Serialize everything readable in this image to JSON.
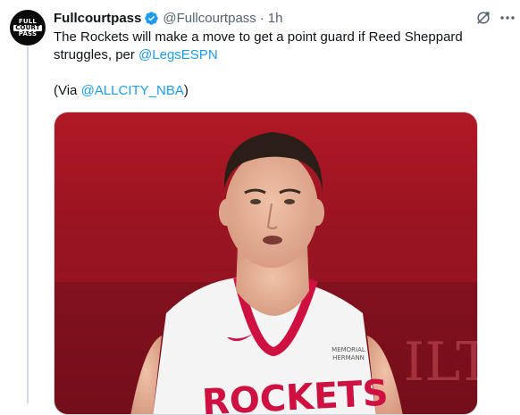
{
  "tweet": {
    "author_name": "Fullcourtpass",
    "author_handle": "@Fullcourtpass",
    "separator": "·",
    "time": "1h",
    "avatar_lines": [
      "FULL",
      "COURT",
      "PASS"
    ],
    "text_main": "The Rockets will make a move to get a point guard if Reed Sheppard struggles, per ",
    "mention_1": "@LegsESPN",
    "via_open": "(Via ",
    "mention_2": "@ALLCITY_NBA",
    "via_close": ")",
    "image": {
      "jersey_text": "ROCKETS",
      "sponsor_line1": "MEMORIAL",
      "sponsor_line2": "HERMANN",
      "background_letters": "ILT"
    }
  },
  "colors": {
    "link": "#1d9bf0",
    "verified": "#1d9bf0",
    "secondary_text": "#536471",
    "jersey_trim": "#ce1141"
  },
  "icons": {
    "verified": "verified-badge-icon",
    "grok": "grok-icon",
    "more": "more-icon"
  }
}
